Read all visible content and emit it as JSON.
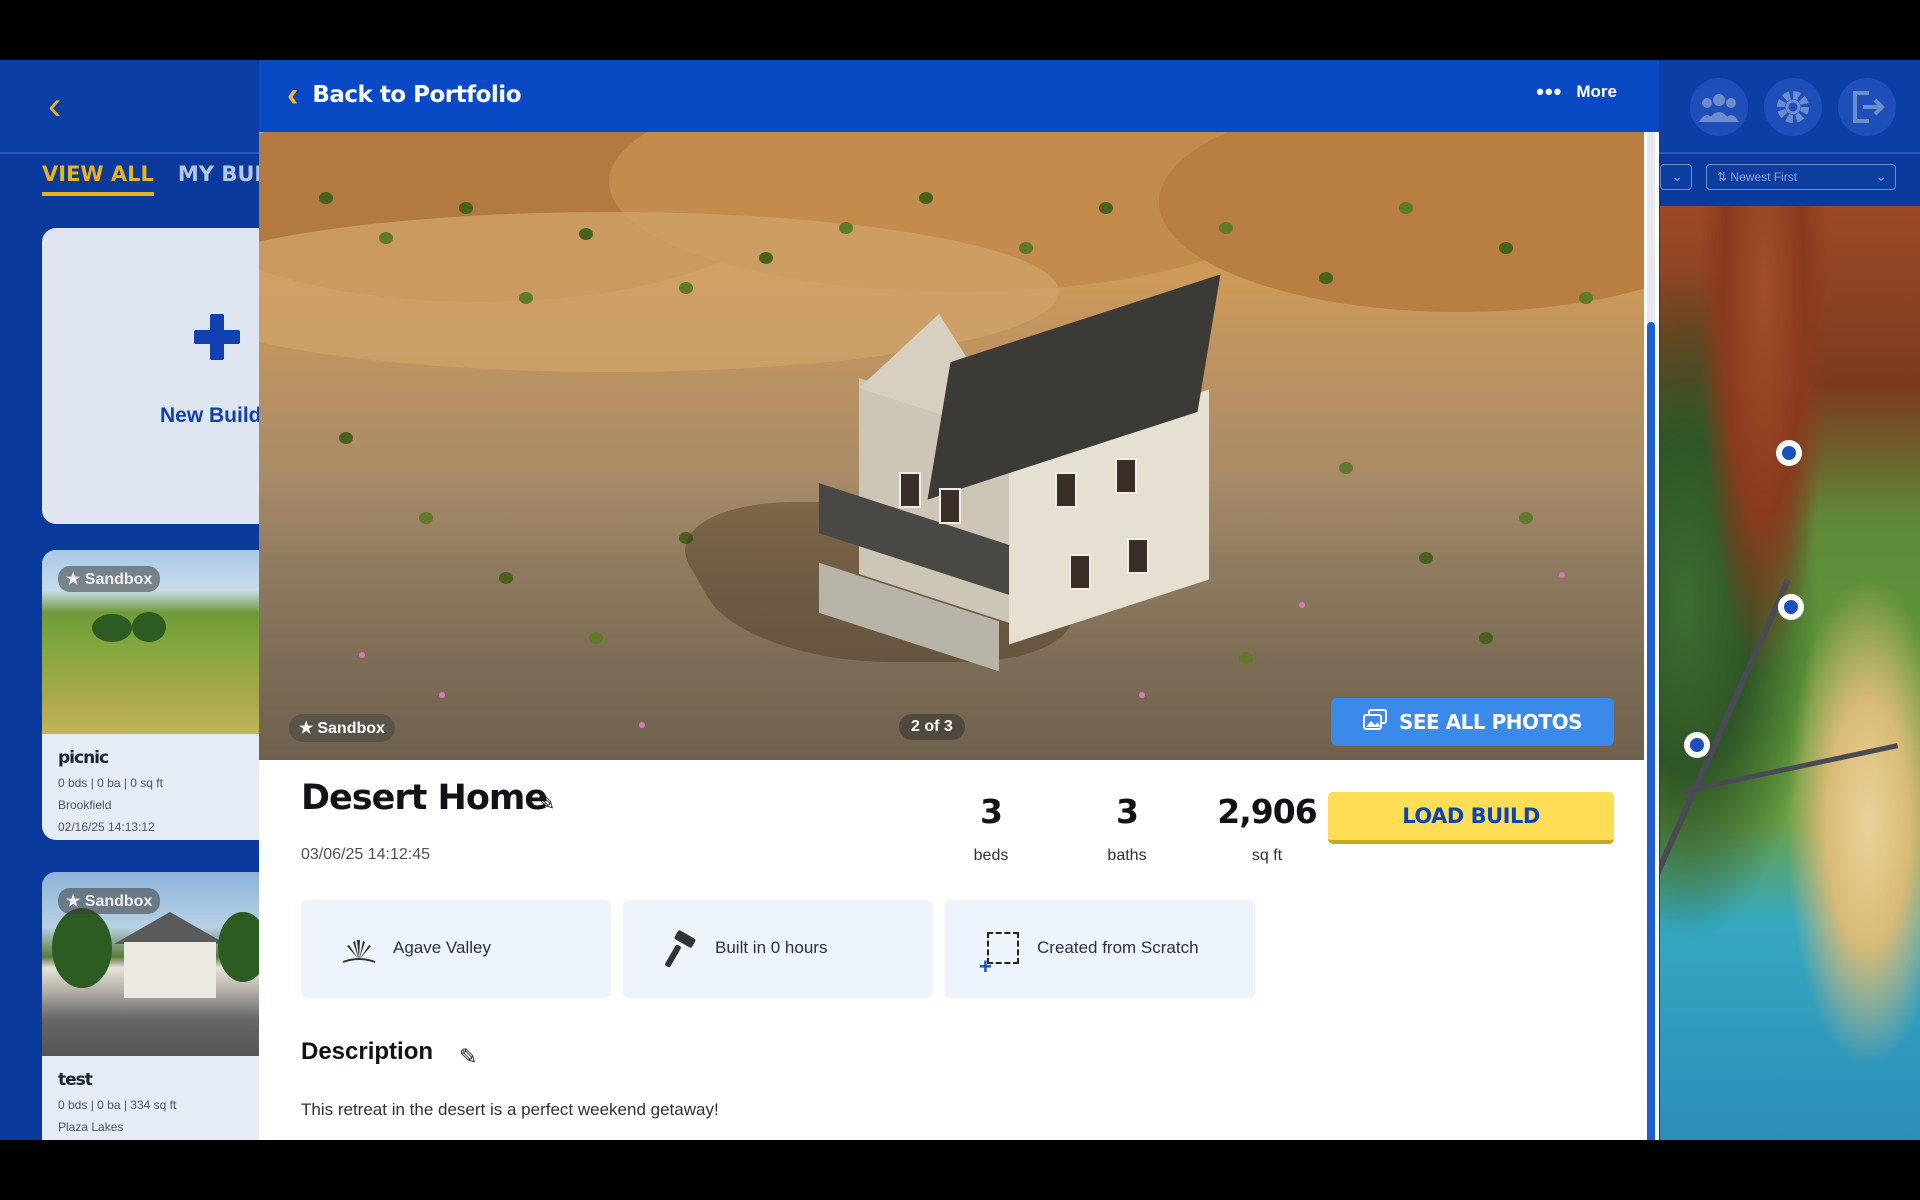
{
  "background": {
    "tabs": [
      {
        "label": "VIEW ALL",
        "active": true
      },
      {
        "label": "MY BUILDS",
        "active": false
      }
    ],
    "new_build_label": "New Build",
    "builds": [
      {
        "badge": "★ Sandbox",
        "title": "picnic",
        "stats": "0 bds | 0 ba | 0 sq ft",
        "location": "Brookfield",
        "date": "02/16/25 14:13:12"
      },
      {
        "badge": "★ Sandbox",
        "title": "test",
        "stats": "0 bds | 0 ba | 334 sq ft",
        "location": "Plaza Lakes"
      }
    ],
    "sort_filter": "Newest First",
    "sort_icon": "sort-arrows-icon",
    "top_icons": [
      "friends-icon",
      "gear-icon",
      "logout-icon"
    ]
  },
  "modal": {
    "back_label": "Back to Portfolio",
    "more_label": "More",
    "hero": {
      "badge": "Sandbox",
      "photo_counter": "2 of 3",
      "see_all_label": "SEE ALL PHOTOS"
    },
    "title": "Desert Home",
    "date": "03/06/25 14:12:45",
    "stats": [
      {
        "value": "3",
        "label": "beds"
      },
      {
        "value": "3",
        "label": "baths"
      },
      {
        "value": "2,906",
        "label": "sq ft"
      }
    ],
    "load_label": "LOAD BUILD",
    "info_cards": [
      {
        "icon": "agave-icon",
        "text": "Agave Valley"
      },
      {
        "icon": "hammer-icon",
        "text": "Built in 0 hours"
      },
      {
        "icon": "scratch-icon",
        "text": "Created from Scratch"
      }
    ],
    "description_title": "Description",
    "description_text": "This retreat in the desert is a perfect weekend getaway!"
  },
  "colors": {
    "header_blue": "#0a49c4",
    "accent_yellow": "#ffdd55",
    "see_all_blue": "#3b8aea",
    "back_chevron": "#f2b92a"
  }
}
